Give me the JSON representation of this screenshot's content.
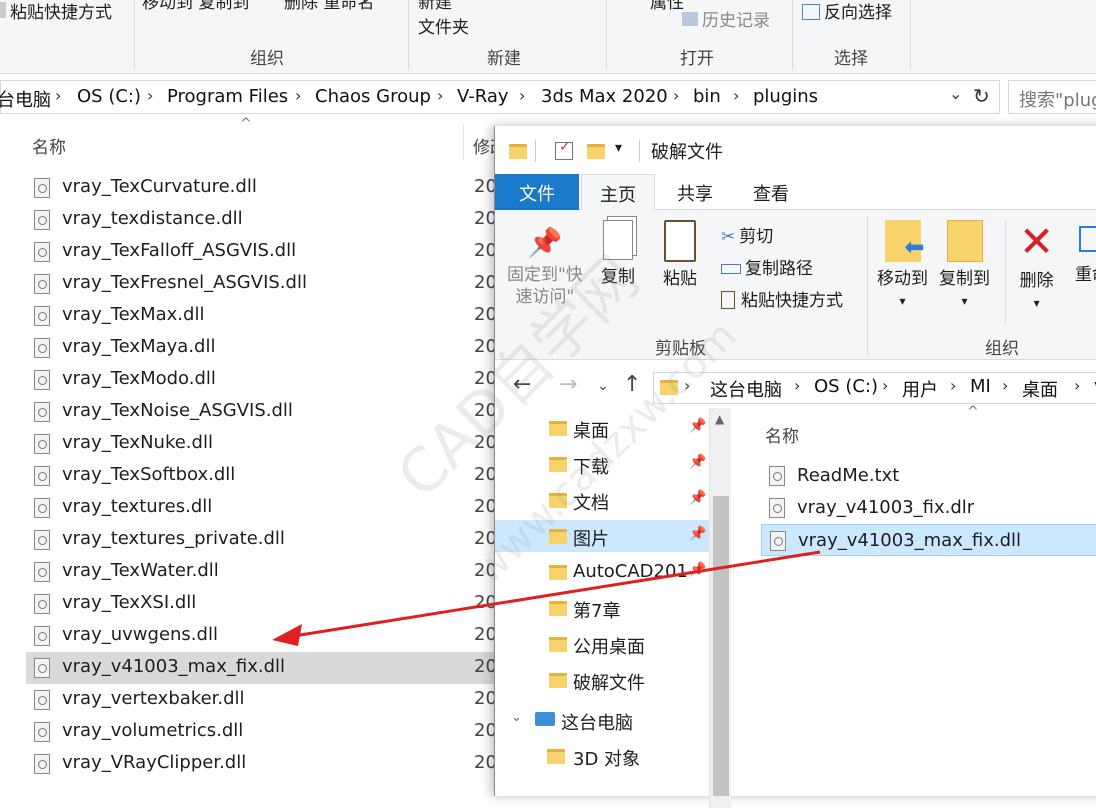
{
  "bg_window": {
    "ribbon": {
      "paste_shortcut": "粘贴快捷方式",
      "move_to": "移动到 复制到",
      "delete": "删除 重命名",
      "new_folder_1": "新建",
      "new_folder_2": "文件夹",
      "properties": "属性",
      "history": "历史记录",
      "invert_select": "反向选择",
      "groups": [
        "组织",
        "新建",
        "打开",
        "选择"
      ]
    },
    "address": {
      "crumbs": [
        "台电脑",
        "OS (C:)",
        "Program Files",
        "Chaos Group",
        "V-Ray",
        "3ds Max 2020",
        "bin",
        "plugins"
      ]
    },
    "search_placeholder": "搜索\"plugins\"",
    "col_name": "名称",
    "col_date": "修改",
    "files": [
      {
        "name": "vray_TexCurvature.dll",
        "date": "20"
      },
      {
        "name": "vray_texdistance.dll",
        "date": "20"
      },
      {
        "name": "vray_TexFalloff_ASGVIS.dll",
        "date": "20"
      },
      {
        "name": "vray_TexFresnel_ASGVIS.dll",
        "date": "20"
      },
      {
        "name": "vray_TexMax.dll",
        "date": "20"
      },
      {
        "name": "vray_TexMaya.dll",
        "date": "20"
      },
      {
        "name": "vray_TexModo.dll",
        "date": "20"
      },
      {
        "name": "vray_TexNoise_ASGVIS.dll",
        "date": "20"
      },
      {
        "name": "vray_TexNuke.dll",
        "date": "20"
      },
      {
        "name": "vray_TexSoftbox.dll",
        "date": "20"
      },
      {
        "name": "vray_textures.dll",
        "date": "20"
      },
      {
        "name": "vray_textures_private.dll",
        "date": "20"
      },
      {
        "name": "vray_TexWater.dll",
        "date": "20"
      },
      {
        "name": "vray_TexXSI.dll",
        "date": "20"
      },
      {
        "name": "vray_uvwgens.dll",
        "date": "20"
      },
      {
        "name": "vray_v41003_max_fix.dll",
        "date": "20"
      },
      {
        "name": "vray_vertexbaker.dll",
        "date": "20"
      },
      {
        "name": "vray_volumetrics.dll",
        "date": "20"
      },
      {
        "name": "vray_VRayClipper.dll",
        "date": "20"
      }
    ]
  },
  "fg_window": {
    "title": "破解文件",
    "tabs": [
      "文件",
      "主页",
      "共享",
      "查看"
    ],
    "ribbon": {
      "pin_1": "固定到\"快",
      "pin_2": "速访问\"",
      "copy": "复制",
      "paste": "粘贴",
      "cut": "剪切",
      "copy_path": "复制路径",
      "paste_shortcut": "粘贴快捷方式",
      "move_to": "移动到",
      "copy_to": "复制到",
      "delete": "删除",
      "rename": "重命",
      "group_clipboard": "剪贴板",
      "group_organize": "组织"
    },
    "address": {
      "crumbs": [
        "这台电脑",
        "OS (C:)",
        "用户",
        "MI",
        "桌面",
        "v"
      ]
    },
    "tree": [
      {
        "label": "桌面",
        "pinned": true
      },
      {
        "label": "下载",
        "pinned": true
      },
      {
        "label": "文档",
        "pinned": true
      },
      {
        "label": "图片",
        "pinned": true
      },
      {
        "label": "AutoCAD201",
        "pinned": true
      },
      {
        "label": "第7章",
        "pinned": false
      },
      {
        "label": "公用桌面",
        "pinned": false
      },
      {
        "label": "破解文件",
        "pinned": false
      },
      {
        "label": "这台电脑",
        "pinned": false
      },
      {
        "label": "3D 对象",
        "pinned": false
      }
    ],
    "col_name": "名称",
    "files": [
      {
        "name": "ReadMe.txt"
      },
      {
        "name": "vray_v41003_fix.dlr"
      },
      {
        "name": "vray_v41003_max_fix.dll"
      }
    ]
  },
  "watermark": "CAD自学网",
  "watermark_url": "www.cadzxw.com",
  "colors": {
    "accent": "#1979ca",
    "arrow": "#e02020",
    "selection": "#cce8ff"
  }
}
